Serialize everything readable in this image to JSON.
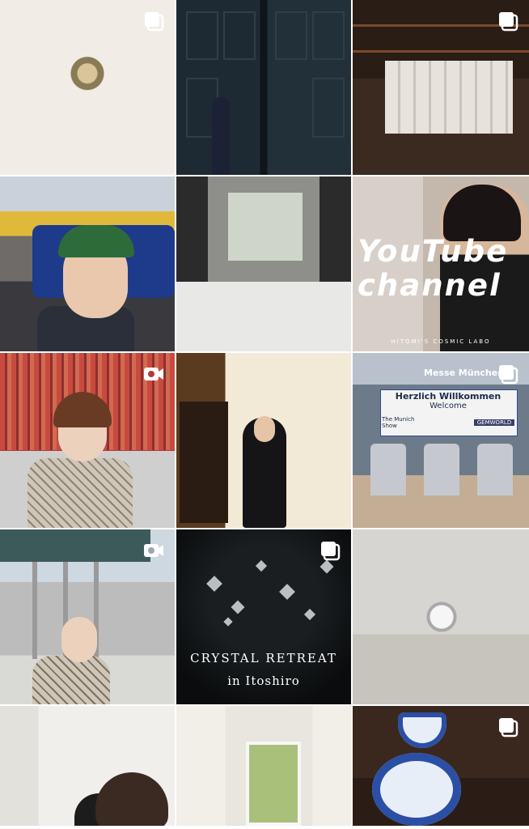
{
  "page": {
    "grid_name": "profile-post-grid"
  },
  "colors": {
    "badge_fill": "#ffffff",
    "background": "#ffffff"
  },
  "posts": [
    {
      "badge": "carousel-icon",
      "texts": []
    },
    {
      "badge": "",
      "texts": []
    },
    {
      "badge": "carousel-icon",
      "texts": []
    },
    {
      "badge": "",
      "texts": []
    },
    {
      "badge": "",
      "texts": []
    },
    {
      "badge": "",
      "texts": [
        "YouTube",
        "channel",
        "HITOMI'S COSMIC LABO"
      ]
    },
    {
      "badge": "video-icon",
      "texts": []
    },
    {
      "badge": "",
      "texts": []
    },
    {
      "badge": "carousel-icon",
      "texts": [
        "Messe München",
        "Herzlich Willkommen",
        "Welcome",
        "The Munich Show",
        "GEMWORLD"
      ]
    },
    {
      "badge": "video-icon",
      "texts": []
    },
    {
      "badge": "carousel-icon",
      "texts": [
        "CRYSTAL RETREAT",
        "in Itoshiro"
      ]
    },
    {
      "badge": "",
      "texts": []
    },
    {
      "badge": "",
      "texts": []
    },
    {
      "badge": "",
      "texts": []
    },
    {
      "badge": "carousel-icon",
      "texts": []
    }
  ]
}
